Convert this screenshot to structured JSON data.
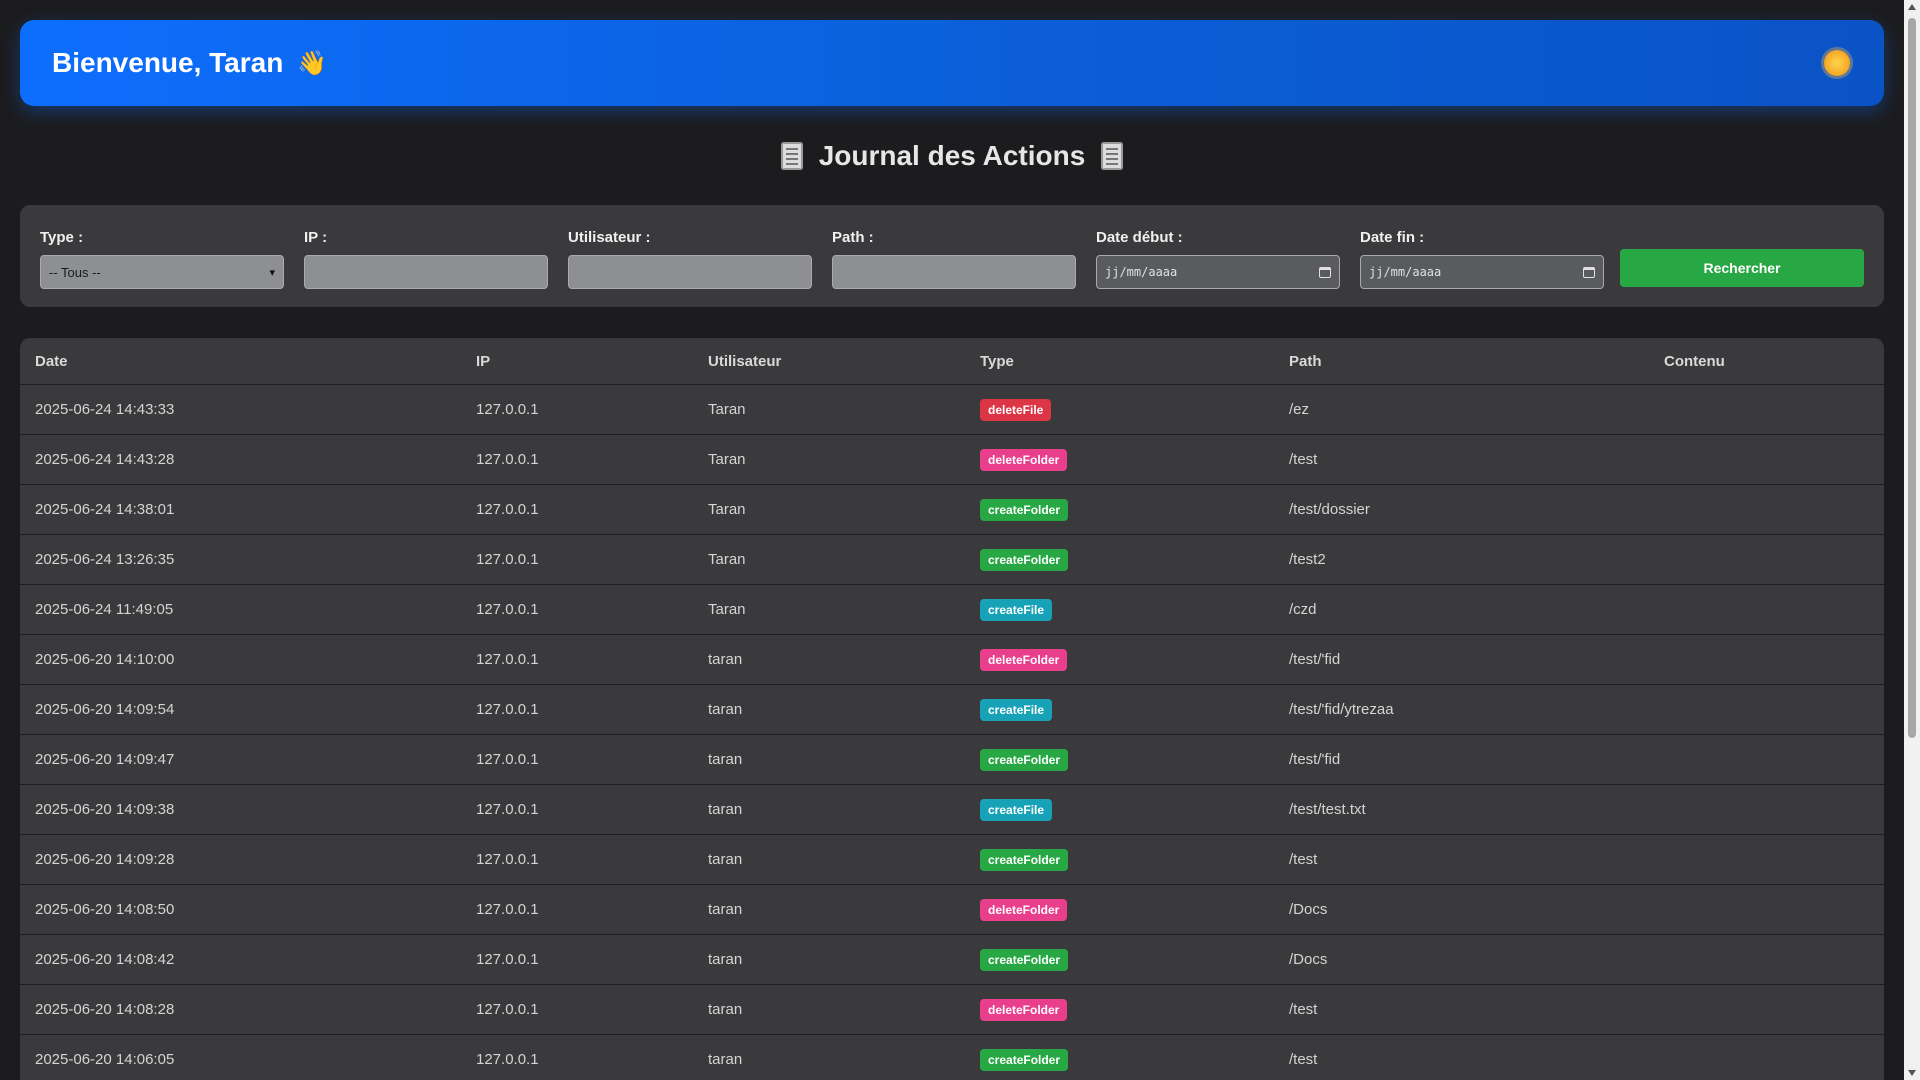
{
  "header": {
    "welcome": "Bienvenue, Taran",
    "wave_emoji": "👋",
    "theme_icon": "sun-icon",
    "color": "#0d6efd"
  },
  "title": "Journal des Actions",
  "filters": {
    "type": {
      "label": "Type :",
      "selected": "-- Tous --"
    },
    "ip": {
      "label": "IP :",
      "value": ""
    },
    "user": {
      "label": "Utilisateur :",
      "value": ""
    },
    "path": {
      "label": "Path :",
      "value": ""
    },
    "date_start": {
      "label": "Date début :",
      "placeholder": "jj/mm/aaaa"
    },
    "date_end": {
      "label": "Date fin :",
      "placeholder": "jj/mm/aaaa"
    },
    "search_label": "Rechercher"
  },
  "table": {
    "columns": [
      "Date",
      "IP",
      "Utilisateur",
      "Type",
      "Path",
      "Contenu"
    ],
    "rows": [
      {
        "date": "2025-06-24 14:43:33",
        "ip": "127.0.0.1",
        "user": "Taran",
        "type": "deleteFile",
        "path": "/ez",
        "content": ""
      },
      {
        "date": "2025-06-24 14:43:28",
        "ip": "127.0.0.1",
        "user": "Taran",
        "type": "deleteFolder",
        "path": "/test",
        "content": ""
      },
      {
        "date": "2025-06-24 14:38:01",
        "ip": "127.0.0.1",
        "user": "Taran",
        "type": "createFolder",
        "path": "/test/dossier",
        "content": ""
      },
      {
        "date": "2025-06-24 13:26:35",
        "ip": "127.0.0.1",
        "user": "Taran",
        "type": "createFolder",
        "path": "/test2",
        "content": ""
      },
      {
        "date": "2025-06-24 11:49:05",
        "ip": "127.0.0.1",
        "user": "Taran",
        "type": "createFile",
        "path": "/czd",
        "content": ""
      },
      {
        "date": "2025-06-20 14:10:00",
        "ip": "127.0.0.1",
        "user": "taran",
        "type": "deleteFolder",
        "path": "/test/'fid",
        "content": ""
      },
      {
        "date": "2025-06-20 14:09:54",
        "ip": "127.0.0.1",
        "user": "taran",
        "type": "createFile",
        "path": "/test/'fid/ytrezaa",
        "content": ""
      },
      {
        "date": "2025-06-20 14:09:47",
        "ip": "127.0.0.1",
        "user": "taran",
        "type": "createFolder",
        "path": "/test/'fid",
        "content": ""
      },
      {
        "date": "2025-06-20 14:09:38",
        "ip": "127.0.0.1",
        "user": "taran",
        "type": "createFile",
        "path": "/test/test.txt",
        "content": ""
      },
      {
        "date": "2025-06-20 14:09:28",
        "ip": "127.0.0.1",
        "user": "taran",
        "type": "createFolder",
        "path": "/test",
        "content": ""
      },
      {
        "date": "2025-06-20 14:08:50",
        "ip": "127.0.0.1",
        "user": "taran",
        "type": "deleteFolder",
        "path": "/Docs",
        "content": ""
      },
      {
        "date": "2025-06-20 14:08:42",
        "ip": "127.0.0.1",
        "user": "taran",
        "type": "createFolder",
        "path": "/Docs",
        "content": ""
      },
      {
        "date": "2025-06-20 14:08:28",
        "ip": "127.0.0.1",
        "user": "taran",
        "type": "deleteFolder",
        "path": "/test",
        "content": ""
      },
      {
        "date": "2025-06-20 14:06:05",
        "ip": "127.0.0.1",
        "user": "taran",
        "type": "createFolder",
        "path": "/test",
        "content": ""
      }
    ]
  },
  "badge_colors": {
    "deleteFile": "#dc3545",
    "deleteFolder": "#e83e8c",
    "createFolder": "#28a745",
    "createFile": "#17a2b8"
  }
}
